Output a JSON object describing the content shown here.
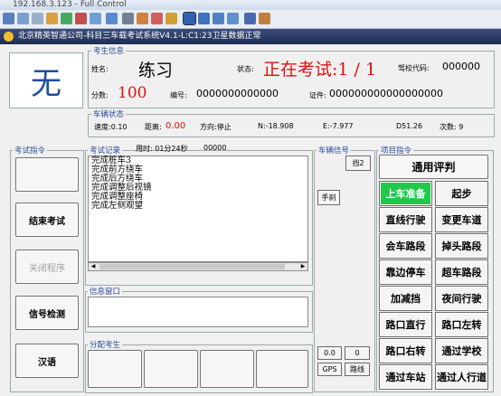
{
  "remote_title": "192.168.3.123 - Full Control",
  "app_title": "北京精英智通公司-科目三车载考试系统V4.1-L:C1:23卫星数据正常",
  "candidate": {
    "group_label": "考生信息",
    "photo_text": "无",
    "name_label": "姓名:",
    "name_value": "练习",
    "status_label": "状态:",
    "status_value": "正在考试:1 / 1",
    "school_label": "驾校代码:",
    "school_value": "000000",
    "score_label": "分数:",
    "score_value": "100",
    "id_label": "编号:",
    "id_value": "0000000000000",
    "cert_label": "证件:",
    "cert_value": "000000000000000000"
  },
  "vehicle": {
    "group_label": "车辆状态",
    "speed": "速度:0.10",
    "distance_label": "距离:",
    "distance_value": "0.00",
    "direction": "方向:停止",
    "n_coord": "N:-18.908",
    "e_coord": "E:-7.977",
    "d_value": "D51.26",
    "count": "次数: 9"
  },
  "exam_cmd": {
    "group_label": "考试指令",
    "end_exam": "结束考试",
    "close_program": "关闭程序",
    "signal_check": "信号检测",
    "chinese": "汉语"
  },
  "exam_log": {
    "group_label": "考试记录",
    "time_text": "用时: 01分24秒",
    "time_code": "00000",
    "items": [
      "完成桩车3",
      "完成前方绕车",
      "完成后方绕车",
      "完成调整后视镜",
      "完成调整座椅",
      "完成左侧观望"
    ]
  },
  "info": {
    "group_label": "信息窗口"
  },
  "assign": {
    "group_label": "分配考生"
  },
  "signal": {
    "group_label": "车辆信号",
    "gear": "挡2",
    "handbrake": "手刹",
    "coord": "0.0",
    "zero": "0",
    "gps": "GPS",
    "path": "路线"
  },
  "project": {
    "group_label": "项目指令",
    "general_review": "通用评判",
    "buttons": [
      "上车准备",
      "起步",
      "直线行驶",
      "变更车道",
      "会车路段",
      "掉头路段",
      "靠边停车",
      "超车路段",
      "加减挡",
      "夜间行驶",
      "路口直行",
      "路口左转",
      "路口右转",
      "通过学校",
      "通过车站",
      "通过人行道"
    ]
  },
  "colors": {
    "status_red": "#e01010",
    "active_green": "#22c84a",
    "group_blue": "#2a4a9a"
  }
}
